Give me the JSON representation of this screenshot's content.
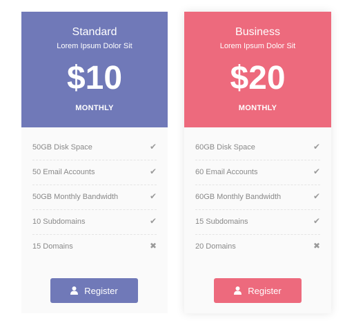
{
  "colors": {
    "standard_accent": "#7079b8",
    "business_accent": "#ed6a7d",
    "card_body": "#fafafa",
    "feature_text": "#888888",
    "mark": "#9a9a9a"
  },
  "plans": [
    {
      "name": "Standard",
      "subtitle": "Lorem Ipsum Dolor Sit",
      "price": "$10",
      "period": "MONTHLY",
      "features": [
        {
          "label": "50GB Disk Space",
          "included": true,
          "mark": "✔"
        },
        {
          "label": "50 Email Accounts",
          "included": true,
          "mark": "✔"
        },
        {
          "label": "50GB Monthly Bandwidth",
          "included": true,
          "mark": "✔"
        },
        {
          "label": "10 Subdomains",
          "included": true,
          "mark": "✔"
        },
        {
          "label": "15 Domains",
          "included": false,
          "mark": "✖"
        }
      ],
      "button": {
        "label": "Register",
        "icon": "user-icon"
      }
    },
    {
      "name": "Business",
      "subtitle": "Lorem Ipsum Dolor Sit",
      "price": "$20",
      "period": "MONTHLY",
      "features": [
        {
          "label": "60GB Disk Space",
          "included": true,
          "mark": "✔"
        },
        {
          "label": "60 Email Accounts",
          "included": true,
          "mark": "✔"
        },
        {
          "label": "60GB Monthly Bandwidth",
          "included": true,
          "mark": "✔"
        },
        {
          "label": "15 Subdomains",
          "included": true,
          "mark": "✔"
        },
        {
          "label": "20 Domains",
          "included": false,
          "mark": "✖"
        }
      ],
      "button": {
        "label": "Register",
        "icon": "user-icon"
      }
    }
  ]
}
